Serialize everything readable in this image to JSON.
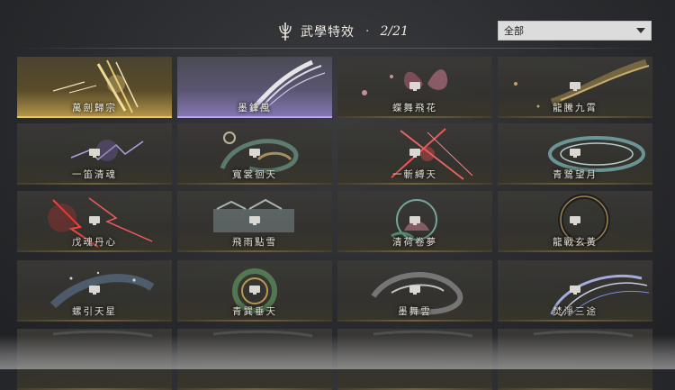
{
  "header": {
    "title": "武學特效",
    "separator": "·",
    "count": "2/21",
    "logo_icon": "trident-emblem-icon"
  },
  "filter": {
    "selected": "全部",
    "arrow_icon": "dropdown-arrow-icon"
  },
  "lock_icon": "lock-icon",
  "colors": {
    "gold_accent": "#e6c46a",
    "purple_accent": "#b6a5e8",
    "bronze_line": "#a88c50",
    "card_base": "#383632"
  },
  "cards": [
    {
      "label": "萬劍歸宗",
      "state": "gold",
      "locked": false,
      "art": "gold-sword-streaks"
    },
    {
      "label": "墨鋒風",
      "state": "purple",
      "locked": false,
      "art": "white-blade-slash"
    },
    {
      "label": "蝶舞飛花",
      "state": "locked",
      "locked": true,
      "art": "pink-butterflies"
    },
    {
      "label": "龍騰九霄",
      "state": "locked",
      "locked": true,
      "art": "gold-dragon-streak"
    },
    {
      "label": "一笛清魂",
      "state": "locked",
      "locked": true,
      "art": "purple-lightning"
    },
    {
      "label": "寬裳徊天",
      "state": "locked",
      "locked": true,
      "art": "teal-swirl-moon"
    },
    {
      "label": "一斬縛天",
      "state": "locked",
      "locked": true,
      "art": "red-cross-slash"
    },
    {
      "label": "青鷺望月",
      "state": "locked",
      "locked": true,
      "art": "teal-ring-wave"
    },
    {
      "label": "戊魂丹心",
      "state": "locked",
      "locked": true,
      "art": "red-lightning"
    },
    {
      "label": "飛雨點雪",
      "state": "locked",
      "locked": true,
      "art": "pale-pagoda-mist"
    },
    {
      "label": "清荷卷夢",
      "state": "locked",
      "locked": true,
      "art": "lotus-circle"
    },
    {
      "label": "龍戰玄黃",
      "state": "locked",
      "locked": true,
      "art": "dark-dragon-ring"
    },
    {
      "label": "螺引天星",
      "state": "locked",
      "locked": true,
      "art": "blue-star-spiral"
    },
    {
      "label": "青巽垂天",
      "state": "locked",
      "locked": true,
      "art": "green-gold-vortex"
    },
    {
      "label": "墨舞雲",
      "state": "locked",
      "locked": true,
      "art": "grey-cloud-swirl"
    },
    {
      "label": "焚淨三途",
      "state": "locked",
      "locked": true,
      "art": "blue-white-arcs"
    },
    {
      "label": "",
      "state": "locked",
      "locked": false,
      "art": "partial-row"
    },
    {
      "label": "",
      "state": "locked",
      "locked": false,
      "art": "partial-row"
    },
    {
      "label": "",
      "state": "locked",
      "locked": false,
      "art": "partial-row"
    },
    {
      "label": "",
      "state": "locked",
      "locked": false,
      "art": "partial-row"
    }
  ]
}
